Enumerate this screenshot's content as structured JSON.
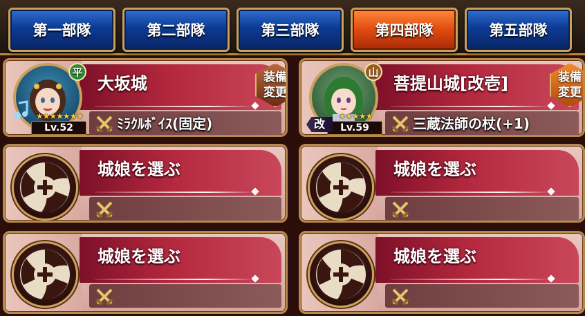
{
  "tabs": [
    {
      "label": "第一部隊",
      "active": false
    },
    {
      "label": "第二部隊",
      "active": false
    },
    {
      "label": "第三部隊",
      "active": false
    },
    {
      "label": "第四部隊",
      "active": true
    },
    {
      "label": "第五部隊",
      "active": false
    }
  ],
  "slots": [
    {
      "type": "girl",
      "name": "大坂城",
      "item": "ﾐﾗｸﾙﾎﾞｲｽ(固定)",
      "level": "Lv.52",
      "terrain": "平",
      "rarity_stars": 7,
      "equip_label_1": "装備",
      "equip_label_2": "変更"
    },
    {
      "type": "girl",
      "name": "菩提山城[改壱]",
      "item": "三蔵法師の杖(+1)",
      "level": "Lv.59",
      "terrain": "山",
      "rarity_stars": 5,
      "remodel_badge": "改",
      "equip_label_1": "装備",
      "equip_label_2": "変更"
    },
    {
      "type": "empty",
      "prompt": "城娘を選ぶ"
    },
    {
      "type": "empty",
      "prompt": "城娘を選ぶ"
    },
    {
      "type": "empty",
      "prompt": "城娘を選ぶ"
    },
    {
      "type": "empty",
      "prompt": "城娘を選ぶ"
    }
  ],
  "colors": {
    "tab_active": "#e04a10",
    "tab_inactive": "#0d3b94",
    "frame_gold": "#c9a15a"
  }
}
